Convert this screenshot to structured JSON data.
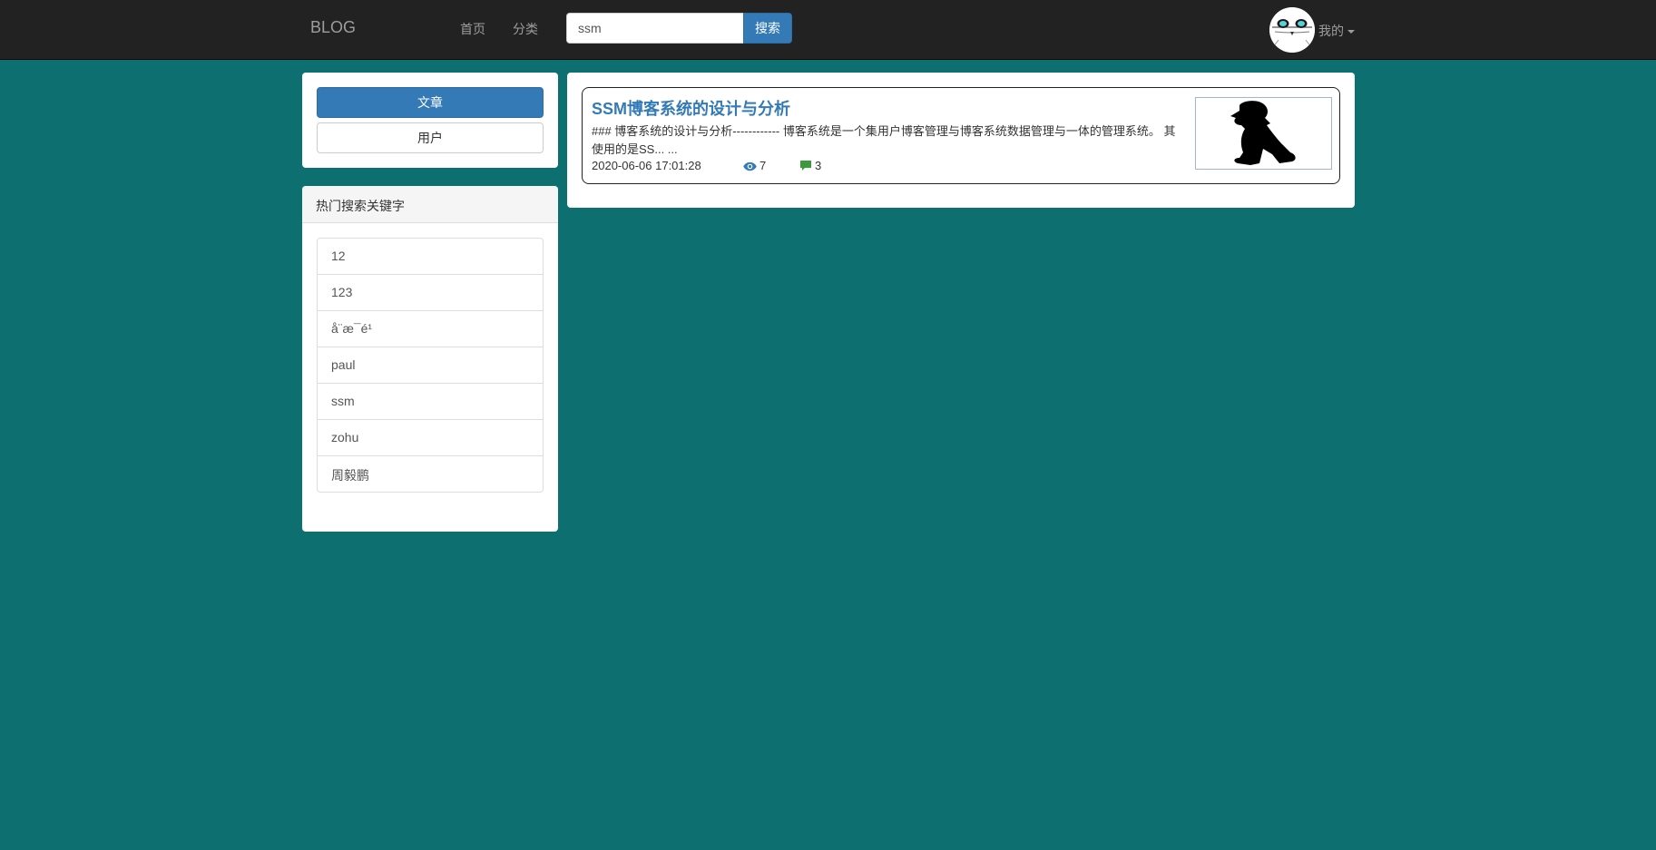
{
  "navbar": {
    "brand": "BLOG",
    "links": [
      "首页",
      "分类"
    ],
    "search": {
      "value": "ssm",
      "button_label": "搜索"
    },
    "user_menu_label": "我的"
  },
  "sidebar": {
    "tabs": {
      "article": "文章",
      "user": "用户"
    },
    "hot_keywords": {
      "title": "热门搜索关键字",
      "items": [
        "12",
        "123",
        "å\u001a¨æ¯\u001aé¹\u001a",
        "paul",
        "ssm",
        "zohu",
        "周毅鹏"
      ]
    }
  },
  "article": {
    "title": "SSM博客系统的设计与分析",
    "summary": "### 博客系统的设计与分析------------ 博客系统是一个集用户博客管理与博客系统数据管理与一体的管理系统。 其使用的是SS... ...",
    "date": "2020-06-06 17:01:28",
    "views": "7",
    "comments": "3"
  },
  "colors": {
    "page_bg": "#0e6f70",
    "navbar_bg": "#222222",
    "primary": "#337ab7",
    "link": "#337ab7",
    "view_icon": "#337ab7",
    "comment_icon": "#3c9a3c"
  },
  "icons": {
    "views": "eye-icon",
    "comments": "comment-icon",
    "user_menu": "caret-down-icon"
  }
}
